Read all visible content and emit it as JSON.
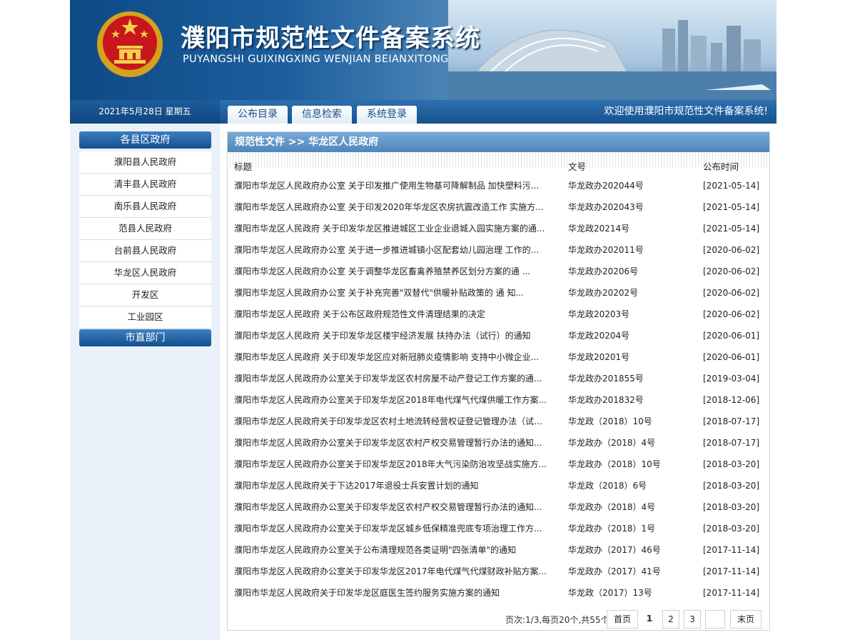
{
  "header": {
    "title_cn": "濮阳市规范性文件备案系统",
    "title_en": "PUYANGSHI GUIXINGXING WENJIAN BEIANXITONG"
  },
  "nav": {
    "date": "2021年5月28日 星期五",
    "tabs": [
      {
        "label": "公布目录"
      },
      {
        "label": "信息检索"
      },
      {
        "label": "系统登录"
      }
    ],
    "welcome": "欢迎使用濮阳市规范性文件备案系统!"
  },
  "sidebar": {
    "section1": "各县区政府",
    "items": [
      {
        "label": "濮阳县人民政府"
      },
      {
        "label": "清丰县人民政府"
      },
      {
        "label": "南乐县人民政府"
      },
      {
        "label": "范县人民政府"
      },
      {
        "label": "台前县人民政府"
      },
      {
        "label": "华龙区人民政府"
      },
      {
        "label": "开发区"
      },
      {
        "label": "工业园区"
      }
    ],
    "section2": "市直部门"
  },
  "main": {
    "breadcrumb": "规范性文件 >> 华龙区人民政府",
    "columns": {
      "title": "标题",
      "doc_no": "文号",
      "date": "公布时间"
    },
    "rows": [
      {
        "title": "濮阳市华龙区人民政府办公室 关于印发推广使用生物基可降解制品 加快塑料污...",
        "doc_no": "华龙政办202044号",
        "date": "[2021-05-14]"
      },
      {
        "title": "濮阳市华龙区人民政府办公室 关于印发2020年华龙区农房抗震改造工作 实施方...",
        "doc_no": "华龙政办202043号",
        "date": "[2021-05-14]"
      },
      {
        "title": "濮阳市华龙区人民政府 关于印发华龙区推进城区工业企业退城入园实施方案的通...",
        "doc_no": "华龙政20214号",
        "date": "[2021-05-14]"
      },
      {
        "title": "濮阳市华龙区人民政府办公室 关于进一步推进城镇小区配套幼儿园治理 工作的...",
        "doc_no": "华龙政办202011号",
        "date": "[2020-06-02]"
      },
      {
        "title": "濮阳市华龙区人民政府办公室 关于调整华龙区畜禽养殖禁养区划分方案的通 ...",
        "doc_no": "华龙政办20206号",
        "date": "[2020-06-02]"
      },
      {
        "title": "濮阳市华龙区人民政府办公室 关于补充完善\"双替代\"供暖补贴政策的 通 知...",
        "doc_no": "华龙政办20202号",
        "date": "[2020-06-02]"
      },
      {
        "title": "濮阳市华龙区人民政府 关于公布区政府规范性文件清理结果的决定",
        "doc_no": "华龙政20203号",
        "date": "[2020-06-02]"
      },
      {
        "title": "濮阳市华龙区人民政府 关于印发华龙区楼宇经济发展 扶持办法（试行）的通知",
        "doc_no": "华龙政20204号",
        "date": "[2020-06-01]"
      },
      {
        "title": "濮阳市华龙区人民政府 关于印发华龙区应对新冠肺炎疫情影响 支持中小微企业...",
        "doc_no": "华龙政20201号",
        "date": "[2020-06-01]"
      },
      {
        "title": "濮阳市华龙区人民政府办公室关于印发华龙区农村房屋不动产登记工作方案的通...",
        "doc_no": "华龙政办201855号",
        "date": "[2019-03-04]"
      },
      {
        "title": "濮阳市华龙区人民政府办公室关于印发华龙区2018年电代煤气代煤供暖工作方案...",
        "doc_no": "华龙政办201832号",
        "date": "[2018-12-06]"
      },
      {
        "title": "濮阳市华龙区人民政府关于印发华龙区农村土地流转经营权证登记管理办法（试行...",
        "doc_no": "华龙政（2018）10号",
        "date": "[2018-07-17]"
      },
      {
        "title": "濮阳市华龙区人民政府办公室关于印发华龙区农村产权交易管理暂行办法的通知...",
        "doc_no": "华龙政办（2018）4号",
        "date": "[2018-07-17]"
      },
      {
        "title": "濮阳市华龙区人民政府办公室关于印发华龙区2018年大气污染防治攻坚战实施方...",
        "doc_no": "华龙政办（2018）10号",
        "date": "[2018-03-20]"
      },
      {
        "title": "濮阳市华龙区人民政府关于下达2017年退役士兵安置计划的通知",
        "doc_no": "华龙政（2018）6号",
        "date": "[2018-03-20]"
      },
      {
        "title": "濮阳市华龙区人民政府办公室关于印发华龙区农村产权交易管理暂行办法的通知...",
        "doc_no": "华龙政办（2018）4号",
        "date": "[2018-03-20]"
      },
      {
        "title": "濮阳市华龙区人民政府办公室关于印发华龙区城乡低保精准兜底专项治理工作方...",
        "doc_no": "华龙政办（2018）1号",
        "date": "[2018-03-20]"
      },
      {
        "title": "濮阳市华龙区人民政府办公室关于公布清理规范各类证明\"四张清单\"的通知",
        "doc_no": "华龙政办（2017）46号",
        "date": "[2017-11-14]"
      },
      {
        "title": "濮阳市华龙区人民政府办公室关于印发华龙区2017年电代煤气代煤财政补贴方案...",
        "doc_no": "华龙政办（2017）41号",
        "date": "[2017-11-14]"
      },
      {
        "title": "濮阳市华龙区人民政府关于印发华龙区庭医生签约服务实施方案的通知",
        "doc_no": "华龙政（2017）13号",
        "date": "[2017-11-14]"
      }
    ]
  },
  "pager": {
    "info": "页次:1/3,每页20个,共55个",
    "first": "首页",
    "current": "1",
    "pages": [
      "2",
      "3"
    ],
    "goto_value": "",
    "last": "末页"
  },
  "colors": {
    "nav_blue": "#16528f",
    "sidebar_bg": "#eaf1f8",
    "head_blue": "#4f86bd"
  }
}
